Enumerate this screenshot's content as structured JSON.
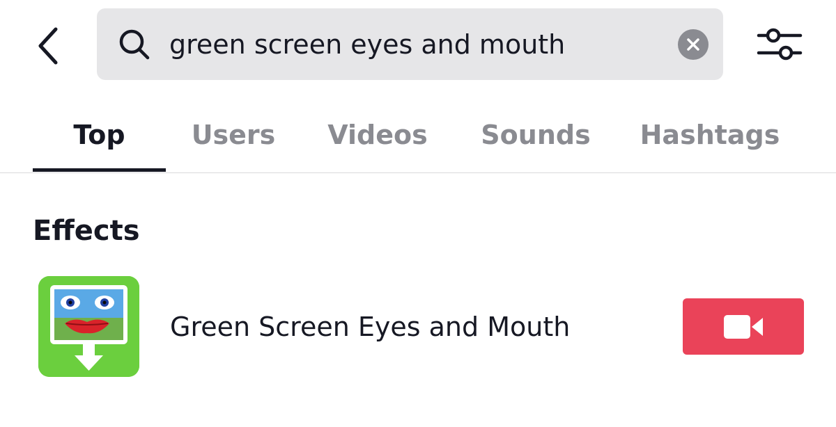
{
  "search": {
    "query": "green screen eyes and mouth",
    "icon": "search-icon"
  },
  "tabs": [
    {
      "label": "Top",
      "active": true
    },
    {
      "label": "Users",
      "active": false
    },
    {
      "label": "Videos",
      "active": false
    },
    {
      "label": "Sounds",
      "active": false
    },
    {
      "label": "Hashtags",
      "active": false
    }
  ],
  "effects": {
    "heading": "Effects",
    "items": [
      {
        "name": "Green Screen Eyes and Mouth",
        "action_icon": "video-camera-icon"
      }
    ]
  },
  "colors": {
    "accent": "#ea4359",
    "search_bg": "#e6e6e8",
    "inactive_tab": "#8a8b91",
    "text": "#161823"
  }
}
